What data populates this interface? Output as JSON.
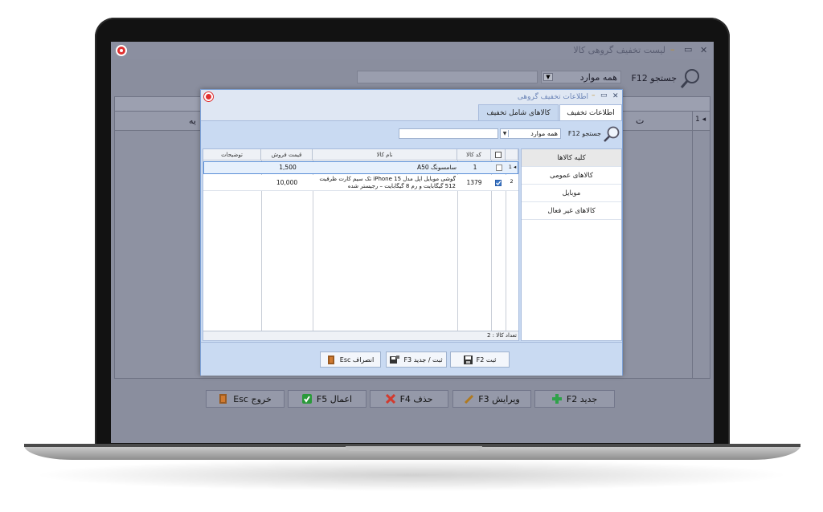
{
  "main_window": {
    "title": "لیست تخفیف گروهی کالا",
    "close_symbol": "✕",
    "maximize_symbol": "▭",
    "minimize_symbol": "–",
    "search_label": "جستجو F12",
    "filter_value": "همه موارد",
    "row_indicator": "◂ 1",
    "header_fragment_left": "یه",
    "header_fragment_right": "ت",
    "buttons": [
      {
        "label": "جدید F2",
        "icon": "plus-icon"
      },
      {
        "label": "ویرایش F3",
        "icon": "pencil-icon"
      },
      {
        "label": "حذف F4",
        "icon": "delete-x-icon"
      },
      {
        "label": "اعمال F5",
        "icon": "check-icon"
      },
      {
        "label": "خروج Esc",
        "icon": "exit-door-icon"
      }
    ]
  },
  "dialog": {
    "title": "اطلاعات تخفیف گروهی",
    "close_symbol": "✕",
    "maximize_symbol": "▭",
    "minimize_symbol": "–",
    "tabs": [
      {
        "label": "اطلاعات تخفیف",
        "active": true
      },
      {
        "label": "کالاهای شامل تخفیف",
        "active": false
      }
    ],
    "search_label": "جستجو F12",
    "filter_value": "همه موارد",
    "categories": [
      "کلیه کالاها",
      "کالاهای عمومی",
      "موبایل",
      "کالاهای غیر فعال"
    ],
    "grid": {
      "columns": [
        "",
        "کد کالا",
        "نام کالا",
        "قیمت فروش",
        "توضیحات"
      ],
      "rows": [
        {
          "indicator": "◂ 1",
          "checked": false,
          "code": "1",
          "name": "سامسونگ A50",
          "price": "1,500",
          "desc": ""
        },
        {
          "indicator": "2",
          "checked": true,
          "code": "1379",
          "name": "گوشی موبایل اپل مدل iPhone 15 تک سیم کارت ظرفیت 512 گیگابایت و رم 8 گیگابایت – رجیستر شده",
          "price": "10,000",
          "desc": ""
        }
      ],
      "footer": "تعداد کالا : 2"
    },
    "buttons": [
      {
        "label": "ثبت F2",
        "icon": "save-icon"
      },
      {
        "label": "ثبت / جدید F3",
        "icon": "save-new-icon"
      },
      {
        "label": "انصراف Esc",
        "icon": "cancel-door-icon"
      }
    ]
  },
  "colors": {
    "dialog_border": "#7da0d4",
    "dialog_bg": "#c9daf2",
    "selected_row": "#e6f0fc",
    "plus_green": "#2fa24a",
    "delete_red": "#d23a2e",
    "check_green": "#2a9a3a"
  }
}
